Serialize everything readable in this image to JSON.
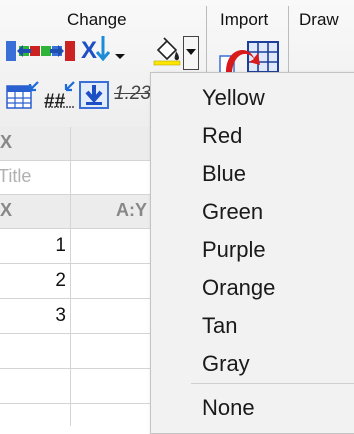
{
  "ribbon": {
    "groups": {
      "change": "Change",
      "import": "Import",
      "draw": "Draw"
    },
    "text_123": "1.23",
    "icons": [
      "move-columns-icon",
      "set-xy-icon",
      "fill-color-icon",
      "dropdown-arrow-icon",
      "import-icon",
      "table-icon",
      "column-insert-icon",
      "number-format-icon",
      "download-icon"
    ]
  },
  "grid": {
    "header_x": "X",
    "placeholder_title": "Title",
    "header_ax": "X",
    "header_ay": "A:Y",
    "rows": [
      "1",
      "2",
      "3"
    ]
  },
  "color_menu": {
    "items": [
      "Yellow",
      "Red",
      "Blue",
      "Green",
      "Purple",
      "Orange",
      "Tan",
      "Gray"
    ],
    "none": "None"
  }
}
